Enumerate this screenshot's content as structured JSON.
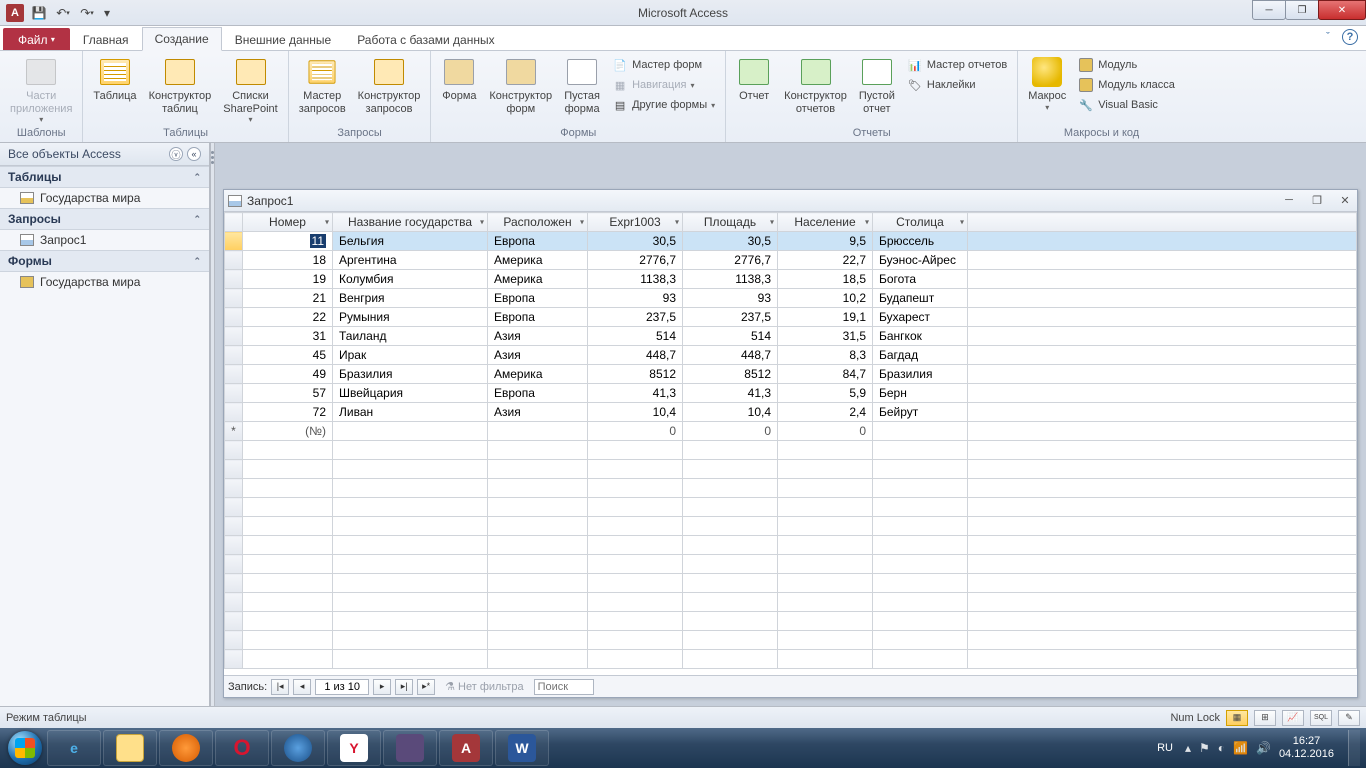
{
  "app": {
    "title": "Microsoft Access"
  },
  "qat": {
    "save": "Сохранить",
    "undo": "Отменить",
    "redo": "Вернуть"
  },
  "tabs": {
    "file": "Файл",
    "items": [
      "Главная",
      "Создание",
      "Внешние данные",
      "Работа с базами данных"
    ],
    "active_index": 1
  },
  "ribbon": {
    "groups": {
      "templates": {
        "label": "Шаблоны",
        "parts": "Части\nприложения"
      },
      "tables": {
        "label": "Таблицы",
        "table": "Таблица",
        "designer": "Конструктор\nтаблиц",
        "sp": "Списки\nSharePoint"
      },
      "queries": {
        "label": "Запросы",
        "wizard": "Мастер\nзапросов",
        "designer": "Конструктор\nзапросов"
      },
      "forms": {
        "label": "Формы",
        "form": "Форма",
        "designer": "Конструктор\nформ",
        "blank": "Пустая\nформа",
        "wizard": "Мастер форм",
        "nav": "Навигация",
        "other": "Другие формы"
      },
      "reports": {
        "label": "Отчеты",
        "report": "Отчет",
        "designer": "Конструктор\nотчетов",
        "blank": "Пустой\nотчет",
        "wizard": "Мастер отчетов",
        "labels": "Наклейки"
      },
      "macros": {
        "label": "Макросы и код",
        "macro": "Макрос",
        "module": "Модуль",
        "classmod": "Модуль класса",
        "vb": "Visual Basic"
      }
    }
  },
  "nav": {
    "header": "Все объекты Access",
    "groups": [
      {
        "title": "Таблицы",
        "items": [
          {
            "label": "Государства мира",
            "type": "tbl"
          }
        ]
      },
      {
        "title": "Запросы",
        "items": [
          {
            "label": "Запрос1",
            "type": "qry"
          }
        ]
      },
      {
        "title": "Формы",
        "items": [
          {
            "label": "Государства мира",
            "type": "frm"
          }
        ]
      }
    ]
  },
  "query": {
    "title": "Запрос1",
    "columns": [
      "Номер",
      "Название государства",
      "Расположен",
      "Expr1003",
      "Площадь",
      "Население",
      "Столица"
    ],
    "rows": [
      {
        "num": "11",
        "name": "Бельгия",
        "loc": "Европа",
        "expr": "30,5",
        "area": "30,5",
        "pop": "9,5",
        "cap": "Брюссель"
      },
      {
        "num": "18",
        "name": "Аргентина",
        "loc": "Америка",
        "expr": "2776,7",
        "area": "2776,7",
        "pop": "22,7",
        "cap": "Буэнос-Айрес"
      },
      {
        "num": "19",
        "name": "Колумбия",
        "loc": "Америка",
        "expr": "1138,3",
        "area": "1138,3",
        "pop": "18,5",
        "cap": "Богота"
      },
      {
        "num": "21",
        "name": "Венгрия",
        "loc": "Европа",
        "expr": "93",
        "area": "93",
        "pop": "10,2",
        "cap": "Будапешт"
      },
      {
        "num": "22",
        "name": "Румыния",
        "loc": "Европа",
        "expr": "237,5",
        "area": "237,5",
        "pop": "19,1",
        "cap": "Бухарест"
      },
      {
        "num": "31",
        "name": "Таиланд",
        "loc": "Азия",
        "expr": "514",
        "area": "514",
        "pop": "31,5",
        "cap": "Бангкок"
      },
      {
        "num": "45",
        "name": "Ирак",
        "loc": "Азия",
        "expr": "448,7",
        "area": "448,7",
        "pop": "8,3",
        "cap": "Багдад"
      },
      {
        "num": "49",
        "name": "Бразилия",
        "loc": "Америка",
        "expr": "8512",
        "area": "8512",
        "pop": "84,7",
        "cap": "Бразилия"
      },
      {
        "num": "57",
        "name": "Швейцария",
        "loc": "Европа",
        "expr": "41,3",
        "area": "41,3",
        "pop": "5,9",
        "cap": "Берн"
      },
      {
        "num": "72",
        "name": "Ливан",
        "loc": "Азия",
        "expr": "10,4",
        "area": "10,4",
        "pop": "2,4",
        "cap": "Бейрут"
      }
    ],
    "newrow": {
      "num": "(№)",
      "expr": "0",
      "area": "0",
      "pop": "0"
    },
    "recnav": {
      "label": "Запись:",
      "pos": "1 из 10",
      "nofilter": "Нет фильтра",
      "search_ph": "Поиск"
    }
  },
  "status": {
    "left": "Режим таблицы",
    "numlock": "Num Lock"
  },
  "taskbar": {
    "lang": "RU",
    "time": "16:27",
    "date": "04.12.2016"
  }
}
